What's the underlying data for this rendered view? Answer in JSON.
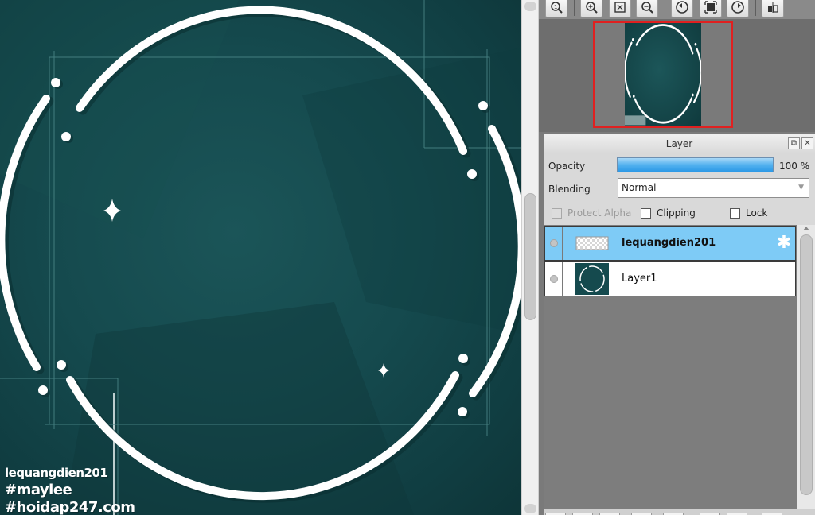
{
  "canvas": {
    "watermark": [
      "lequangdien201",
      "#maylee",
      "#hoidap247.com"
    ],
    "colors": {
      "background": "#154a4e",
      "ring": "#ffffff"
    }
  },
  "toolbar": {
    "icons": [
      "zoom-fit-icon",
      "zoom-in-icon",
      "fit-screen-icon",
      "zoom-out-icon",
      "rotate-left-icon",
      "fullscreen-icon",
      "rotate-right-icon",
      "flip-icon"
    ]
  },
  "layer_panel": {
    "title": "Layer",
    "opacity_label": "Opacity",
    "opacity_value": "100 %",
    "opacity_fraction": 1.0,
    "blending_label": "Blending",
    "blending_value": "Normal",
    "protect_alpha_label": "Protect Alpha",
    "clipping_label": "Clipping",
    "lock_label": "Lock",
    "layers": [
      {
        "name": "lequangdien201",
        "selected": true
      },
      {
        "name": "Layer1",
        "selected": false
      }
    ],
    "colors": {
      "selected_row": "#7ecbf6",
      "opacity_fill": "#3ea4ea"
    }
  }
}
